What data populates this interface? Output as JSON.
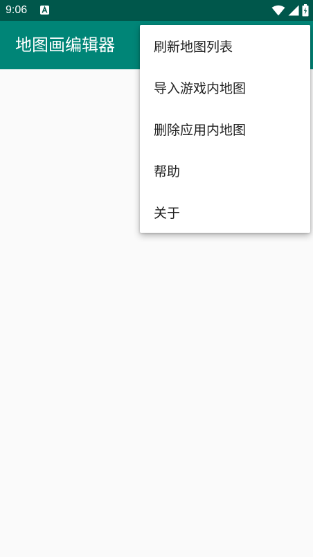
{
  "status_bar": {
    "time": "9:06",
    "notification_icon": "a-letter-icon",
    "icons": [
      "wifi-icon",
      "cell-signal-icon",
      "battery-charging-icon"
    ],
    "color": "#00574b"
  },
  "app_bar": {
    "title": "地图画编辑器",
    "color": "#008577"
  },
  "menu": {
    "items": [
      {
        "label": "刷新地图列表"
      },
      {
        "label": "导入游戏内地图"
      },
      {
        "label": "删除应用内地图"
      },
      {
        "label": "帮助"
      },
      {
        "label": "关于"
      }
    ]
  }
}
